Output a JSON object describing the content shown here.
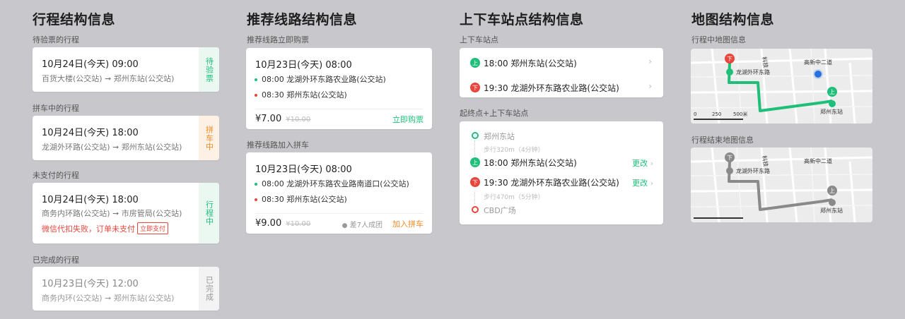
{
  "col1": {
    "title": "行程结构信息",
    "sections": [
      {
        "label": "待验票的行程",
        "time": "10月24日(今天) 09:00",
        "route": "百货大楼(公交站) ➞ 郑州东站(公交站)",
        "status": "待验票",
        "status_color": "#1fbf7a"
      },
      {
        "label": "拼车中的行程",
        "time": "10月24日(今天) 18:00",
        "route": "龙湖外环路(公交站) ➞ 郑州东站(公交站)",
        "status": "拼车中",
        "status_color": "#f08a24"
      },
      {
        "label": "未支付的行程",
        "time": "10月24日(今天) 18:00",
        "route": "商务内环路(公交站) ➞ 市房管局(公交站)",
        "warn": "微信代扣失败，订单未支付",
        "pay_btn": "立即支付",
        "status": "行程中",
        "status_color": "#1fbf7a"
      },
      {
        "label": "已完成的行程",
        "time": "10月23日(今天) 12:00",
        "route": "商务内环(公交站) ➞ 郑州东站(公交站)",
        "status": "已完成",
        "status_color": "#999999"
      }
    ]
  },
  "col2": {
    "title": "推荐线路结构信息",
    "buy": {
      "label": "推荐线路立即购票",
      "time": "10月23日(今天) 08:00",
      "stops": [
        {
          "time": "08:00",
          "name": "龙湖外环东路农业路(公交站)"
        },
        {
          "time": "08:30",
          "name": "郑州东站(公交站)"
        }
      ],
      "price": "¥7.00",
      "orig": "¥10.00",
      "action": "立即购票"
    },
    "join": {
      "label": "推荐线路加入拼车",
      "time": "10月23日(今天) 08:00",
      "stops": [
        {
          "time": "08:00",
          "name": "龙湖外环东路农业路南道口(公交站)"
        },
        {
          "time": "08:30",
          "name": "郑州东站(公交站)"
        }
      ],
      "price": "¥9.00",
      "orig": "¥10.00",
      "need": "差7人成团",
      "action": "加入拼车"
    }
  },
  "col3": {
    "title": "上下车站点结构信息",
    "section1": {
      "label": "上下车站点",
      "rows": [
        {
          "badge": "上",
          "text": "18:00 郑州东站(公交站)"
        },
        {
          "badge": "下",
          "text": "19:30 龙湖外环东路农业路(公交站)"
        }
      ]
    },
    "section2": {
      "label": "起终点+上下车站点",
      "start": "郑州东站",
      "walk1": "步行320m（4分钟）",
      "on": "18:00 郑州东站(公交站)",
      "off": "19:30 龙湖外环东路农业路(公交站)",
      "walk2": "步行470m（5分钟）",
      "end": "CBD广场",
      "change": "更改"
    }
  },
  "col4": {
    "title": "地图结构信息",
    "map1": {
      "label": "行程中地图信息"
    },
    "map2": {
      "label": "行程结束地图信息"
    },
    "map_labels": {
      "road1": "高新中二道",
      "road2": "科技",
      "stop1": "龙湖外环东路",
      "stop2": "郑州东站",
      "scale0": "0",
      "scale1": "250",
      "scale2": "500米",
      "on": "上",
      "off": "下"
    }
  },
  "colors": {
    "green": "#1fbf7a",
    "orange": "#f08a24",
    "red": "#e8453c",
    "route_gray": "#8a8a8a"
  }
}
